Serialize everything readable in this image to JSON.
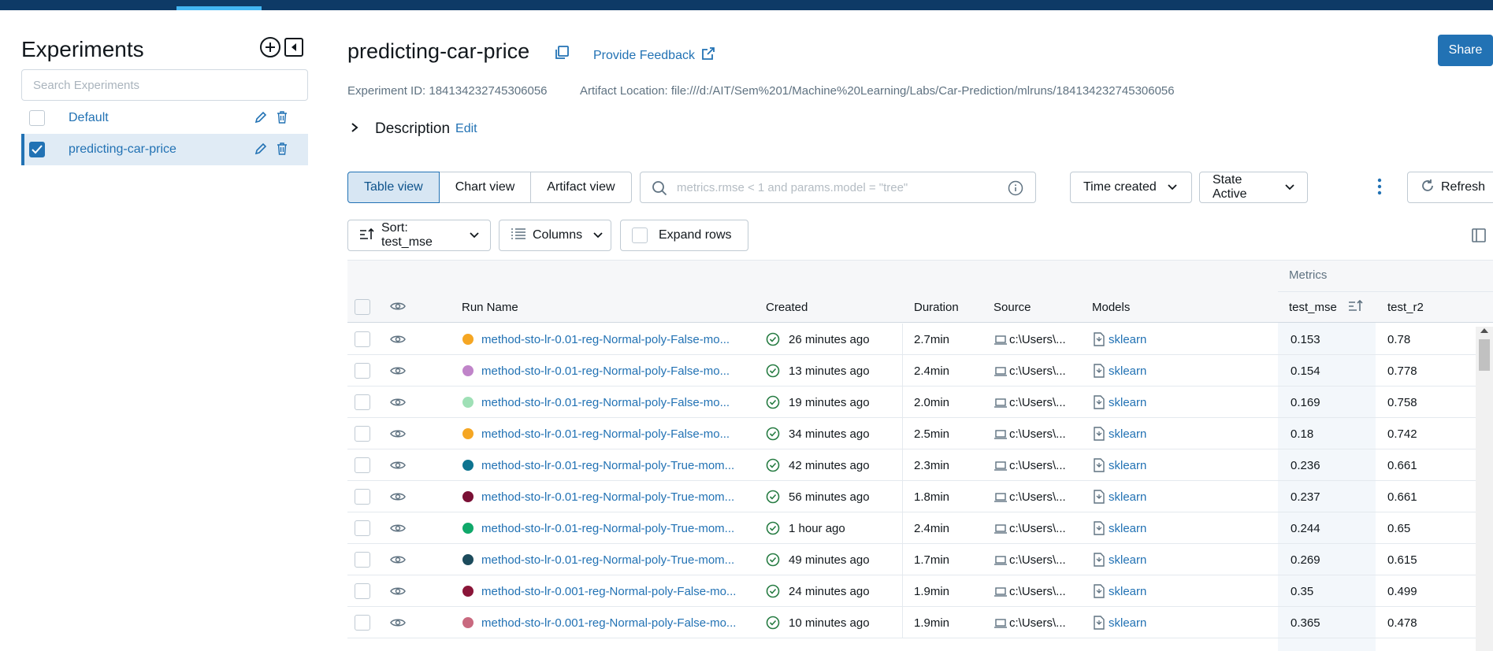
{
  "sidebar": {
    "title": "Experiments",
    "search_placeholder": "Search Experiments",
    "experiments": [
      {
        "name": "Default",
        "checked": false
      },
      {
        "name": "predicting-car-price",
        "checked": true
      }
    ]
  },
  "header": {
    "title": "predicting-car-price",
    "feedback_label": "Provide Feedback",
    "share_label": "Share",
    "experiment_id_label": "Experiment ID: 184134232745306056",
    "artifact_location_label": "Artifact Location: file:///d:/AIT/Sem%201/Machine%20Learning/Labs/Car-Prediction/mlruns/184134232745306056",
    "description_label": "Description",
    "description_edit": "Edit"
  },
  "toolbar": {
    "views": [
      "Table view",
      "Chart view",
      "Artifact view"
    ],
    "active_view": "Table view",
    "filter_placeholder": "metrics.rmse < 1 and params.model = \"tree\"",
    "time_created": "Time created",
    "state_label": "State",
    "state_value": "Active",
    "refresh_label": "Refresh",
    "sort_label": "Sort: test_mse",
    "columns_label": "Columns",
    "expand_rows_label": "Expand rows"
  },
  "table": {
    "group_header": "Metrics",
    "columns": {
      "run_name": "Run Name",
      "created": "Created",
      "duration": "Duration",
      "source": "Source",
      "models": "Models",
      "test_mse": "test_mse",
      "test_r2": "test_r2"
    },
    "rows": [
      {
        "color": "#f5a623",
        "run_name": "method-sto-lr-0.01-reg-Normal-poly-False-mo...",
        "created": "26 minutes ago",
        "duration": "2.7min",
        "source": "c:\\Users\\...",
        "model": "sklearn",
        "test_mse": "0.153",
        "test_r2": "0.78"
      },
      {
        "color": "#c084c9",
        "run_name": "method-sto-lr-0.01-reg-Normal-poly-False-mo...",
        "created": "13 minutes ago",
        "duration": "2.4min",
        "source": "c:\\Users\\...",
        "model": "sklearn",
        "test_mse": "0.154",
        "test_r2": "0.778"
      },
      {
        "color": "#9fe0b6",
        "run_name": "method-sto-lr-0.01-reg-Normal-poly-False-mo...",
        "created": "19 minutes ago",
        "duration": "2.0min",
        "source": "c:\\Users\\...",
        "model": "sklearn",
        "test_mse": "0.169",
        "test_r2": "0.758"
      },
      {
        "color": "#f5a623",
        "run_name": "method-sto-lr-0.01-reg-Normal-poly-False-mo...",
        "created": "34 minutes ago",
        "duration": "2.5min",
        "source": "c:\\Users\\...",
        "model": "sklearn",
        "test_mse": "0.18",
        "test_r2": "0.742"
      },
      {
        "color": "#0e7490",
        "run_name": "method-sto-lr-0.01-reg-Normal-poly-True-mom...",
        "created": "42 minutes ago",
        "duration": "2.3min",
        "source": "c:\\Users\\...",
        "model": "sklearn",
        "test_mse": "0.236",
        "test_r2": "0.661"
      },
      {
        "color": "#7a1035",
        "run_name": "method-sto-lr-0.01-reg-Normal-poly-True-mom...",
        "created": "56 minutes ago",
        "duration": "1.8min",
        "source": "c:\\Users\\...",
        "model": "sklearn",
        "test_mse": "0.237",
        "test_r2": "0.661"
      },
      {
        "color": "#10a86a",
        "run_name": "method-sto-lr-0.01-reg-Normal-poly-True-mom...",
        "created": "1 hour ago",
        "duration": "2.4min",
        "source": "c:\\Users\\...",
        "model": "sklearn",
        "test_mse": "0.244",
        "test_r2": "0.65"
      },
      {
        "color": "#1c4b5c",
        "run_name": "method-sto-lr-0.01-reg-Normal-poly-True-mom...",
        "created": "49 minutes ago",
        "duration": "1.7min",
        "source": "c:\\Users\\...",
        "model": "sklearn",
        "test_mse": "0.269",
        "test_r2": "0.615"
      },
      {
        "color": "#8a1538",
        "run_name": "method-sto-lr-0.001-reg-Normal-poly-False-mo...",
        "created": "24 minutes ago",
        "duration": "1.9min",
        "source": "c:\\Users\\...",
        "model": "sklearn",
        "test_mse": "0.35",
        "test_r2": "0.499"
      },
      {
        "color": "#c9697f",
        "run_name": "method-sto-lr-0.001-reg-Normal-poly-False-mo...",
        "created": "10 minutes ago",
        "duration": "1.9min",
        "source": "c:\\Users\\...",
        "model": "sklearn",
        "test_mse": "0.365",
        "test_r2": "0.478"
      }
    ]
  }
}
